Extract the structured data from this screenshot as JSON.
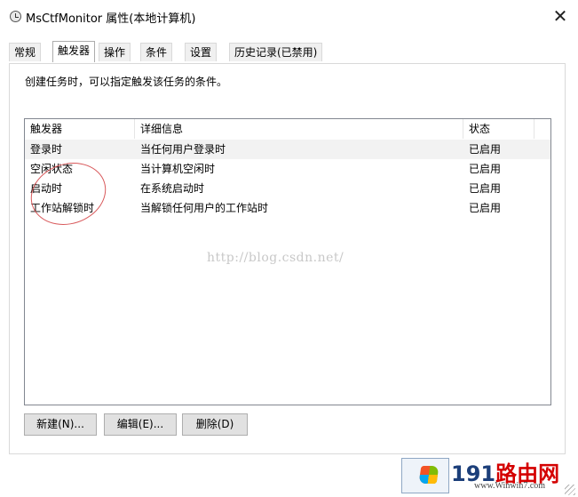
{
  "window": {
    "title": "MsCtfMonitor 属性(本地计算机)",
    "close_glyph": "✕"
  },
  "tabs": [
    {
      "label": "常规",
      "active": false
    },
    {
      "label": "触发器",
      "active": true
    },
    {
      "label": "操作",
      "active": false
    },
    {
      "label": "条件",
      "active": false
    },
    {
      "label": "设置",
      "active": false
    },
    {
      "label": "历史记录(已禁用)",
      "active": false
    }
  ],
  "panel": {
    "description": "创建任务时，可以指定触发该任务的条件。"
  },
  "triggers_table": {
    "columns": [
      "触发器",
      "详细信息",
      "状态"
    ],
    "rows": [
      {
        "trigger": "登录时",
        "details": "当任何用户登录时",
        "status": "已启用",
        "selected": true
      },
      {
        "trigger": "空闲状态",
        "details": "当计算机空闲时",
        "status": "已启用",
        "selected": false
      },
      {
        "trigger": "启动时",
        "details": "在系统启动时",
        "status": "已启用",
        "selected": false
      },
      {
        "trigger": "工作站解锁时",
        "details": "当解锁任何用户的工作站时",
        "status": "已启用",
        "selected": false
      }
    ]
  },
  "watermark": "http://blog.csdn.net/",
  "buttons": {
    "new_label": "新建(N)...",
    "edit_label": "编辑(E)...",
    "delete_label": "删除(D)"
  },
  "logo": {
    "number": "191",
    "name": "路由网",
    "url": "www.Winwin7.com"
  },
  "icons": {
    "app": "task-scheduler-clock-icon",
    "close": "close-icon",
    "logo": "windows-logo-icon"
  }
}
